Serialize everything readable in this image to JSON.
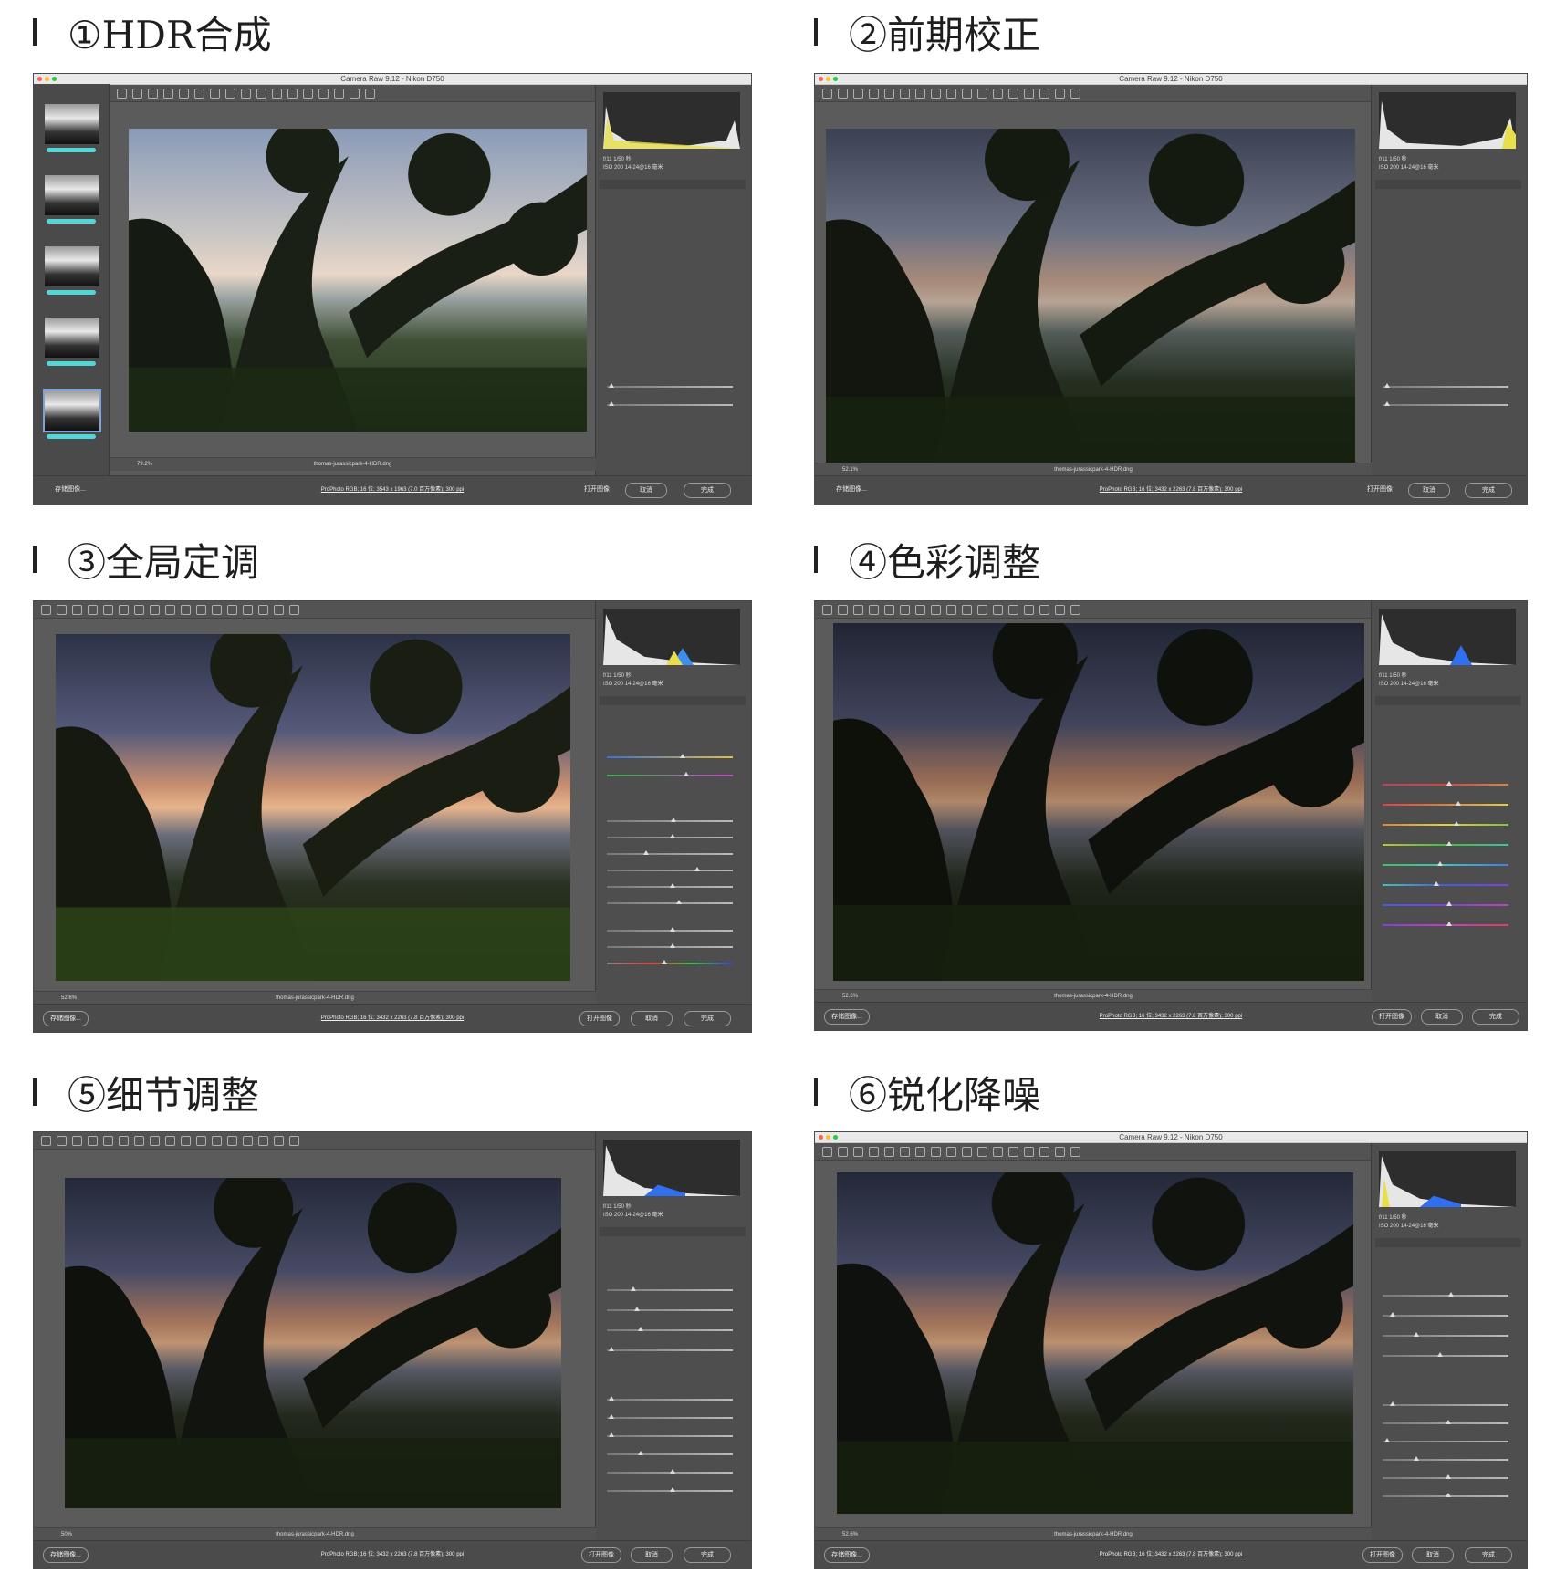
{
  "panels": [
    {
      "heading": "①HDR合成",
      "window_title": "Camera Raw 9.12 - Nikon D750",
      "filename": "thomas-jurassicpark-4-HDR.dng",
      "zoom": "79.2%",
      "info": "ProPhoto RGB; 16 位; 3543 x 1963 (7.0 百万像素); 300 ppi",
      "buttons": {
        "save": "存储图像...",
        "open": "打开图像",
        "cancel": "取消",
        "done": "完成"
      }
    },
    {
      "heading": "②前期校正",
      "window_title": "Camera Raw 9.12 - Nikon D750",
      "filename": "thomas-jurassicpark-4-HDR.dng",
      "zoom": "52.1%",
      "info": "ProPhoto RGB; 16 位; 3432 x 2263 (7.8 百万像素); 300 ppi",
      "buttons": {
        "save": "存储图像...",
        "open": "打开图像",
        "cancel": "取消",
        "done": "完成"
      }
    },
    {
      "heading": "③全局定调",
      "window_title": "",
      "filename": "thomas-jurassicpark-4-HDR.dng",
      "zoom": "52.6%",
      "info": "ProPhoto RGB; 16 位; 3432 x 2263 (7.8 百万像素); 300 ppi",
      "buttons": {
        "save": "存储图像...",
        "open": "打开图像",
        "cancel": "取消",
        "done": "完成"
      }
    },
    {
      "heading": "④色彩调整",
      "window_title": "",
      "filename": "thomas-jurassicpark-4-HDR.dng",
      "zoom": "52.6%",
      "info": "ProPhoto RGB; 16 位; 3432 x 2263 (7.8 百万像素); 300 ppi",
      "buttons": {
        "save": "存储图像...",
        "open": "打开图像",
        "cancel": "取消",
        "done": "完成"
      }
    },
    {
      "heading": "⑤细节调整",
      "window_title": "",
      "filename": "thomas-jurassicpark-4-HDR.dng",
      "zoom": "50%",
      "info": "ProPhoto RGB; 16 位; 3432 x 2263 (7.8 百万像素); 300 ppi",
      "buttons": {
        "save": "存储图像...",
        "open": "打开图像",
        "cancel": "取消",
        "done": "完成"
      }
    },
    {
      "heading": "⑥锐化降噪",
      "window_title": "Camera Raw 9.12 - Nikon D750",
      "filename": "thomas-jurassicpark-4-HDR.dng",
      "zoom": "52.6%",
      "info": "ProPhoto RGB; 16 位; 3432 x 2263 (7.8 百万像素); 300 ppi",
      "buttons": {
        "save": "存储图像...",
        "open": "打开图像",
        "cancel": "取消",
        "done": "完成"
      }
    }
  ],
  "camera_meta": {
    "aperture": "f/11",
    "shutter": "1/50 秒",
    "iso": "ISO 200",
    "lens": "14-24@16 毫米"
  },
  "colors": {
    "ui_bg": "#5b5b5b",
    "panel_bg": "#4e4e4e",
    "heading": "#1e1e1e",
    "thumb_bar": "#54d6d6"
  },
  "icons": [
    "zoom-icon",
    "hand-icon",
    "white-balance-icon",
    "color-sampler-icon",
    "target-adjust-icon",
    "crop-icon",
    "straighten-icon",
    "transform-icon",
    "spot-removal-icon",
    "red-eye-icon",
    "brush-icon",
    "graduated-filter-icon",
    "radial-filter-icon",
    "preferences-icon",
    "rotate-left-icon",
    "rotate-right-icon",
    "trash-icon"
  ]
}
